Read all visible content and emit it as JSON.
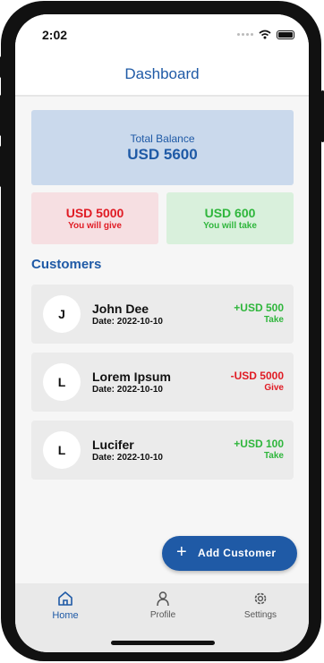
{
  "status_bar": {
    "time": "2:02"
  },
  "header": {
    "title": "Dashboard"
  },
  "balance": {
    "label": "Total Balance",
    "value": "USD 5600"
  },
  "give": {
    "amount": "USD 5000",
    "label": "You will give"
  },
  "take": {
    "amount": "USD 600",
    "label": "You will take"
  },
  "customers": {
    "title": "Customers",
    "items": [
      {
        "initial": "J",
        "name": "John Dee",
        "date": "Date: 2022-10-10",
        "amount": "+USD 500",
        "type": "Take",
        "status_color": "#2fb63c"
      },
      {
        "initial": "L",
        "name": "Lorem Ipsum",
        "date": "Date: 2022-10-10",
        "amount": "-USD 5000",
        "type": "Give",
        "status_color": "#e01b24"
      },
      {
        "initial": "L",
        "name": "Lucifer",
        "date": "Date: 2022-10-10",
        "amount": "+USD 100",
        "type": "Take",
        "status_color": "#2fb63c"
      }
    ]
  },
  "fab": {
    "label": "Add Customer",
    "icon": "plus-icon"
  },
  "nav": {
    "items": [
      {
        "label": "Home",
        "icon": "home-icon",
        "active": true
      },
      {
        "label": "Profile",
        "icon": "person-icon",
        "active": false
      },
      {
        "label": "Settings",
        "icon": "gear-icon",
        "active": false
      }
    ]
  },
  "colors": {
    "accent": "#1f5aa6",
    "give": "#e01b24",
    "take": "#2fb63c"
  }
}
